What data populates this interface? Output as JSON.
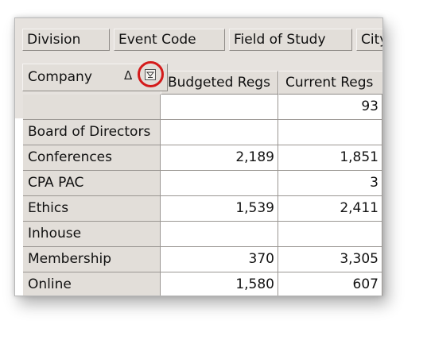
{
  "page_fields": [
    "Division",
    "Event Code",
    "Field of Study",
    "City"
  ],
  "row_field": {
    "label": "Company",
    "sort_icon": "sort-ascending-icon",
    "filter_icon": "filter-dropdown-icon",
    "highlight_color": "#d41a1a"
  },
  "columns": [
    "Budgeted Regs",
    "Current Regs"
  ],
  "rows": [
    {
      "label": "",
      "budgeted": "",
      "current": "93"
    },
    {
      "label": "Board of Directors",
      "budgeted": "",
      "current": ""
    },
    {
      "label": "Conferences",
      "budgeted": "2,189",
      "current": "1,851"
    },
    {
      "label": "CPA PAC",
      "budgeted": "",
      "current": "3"
    },
    {
      "label": "Ethics",
      "budgeted": "1,539",
      "current": "2,411"
    },
    {
      "label": "Inhouse",
      "budgeted": "",
      "current": ""
    },
    {
      "label": "Membership",
      "budgeted": "370",
      "current": "3,305"
    },
    {
      "label": "Online",
      "budgeted": "1,580",
      "current": "607"
    }
  ]
}
